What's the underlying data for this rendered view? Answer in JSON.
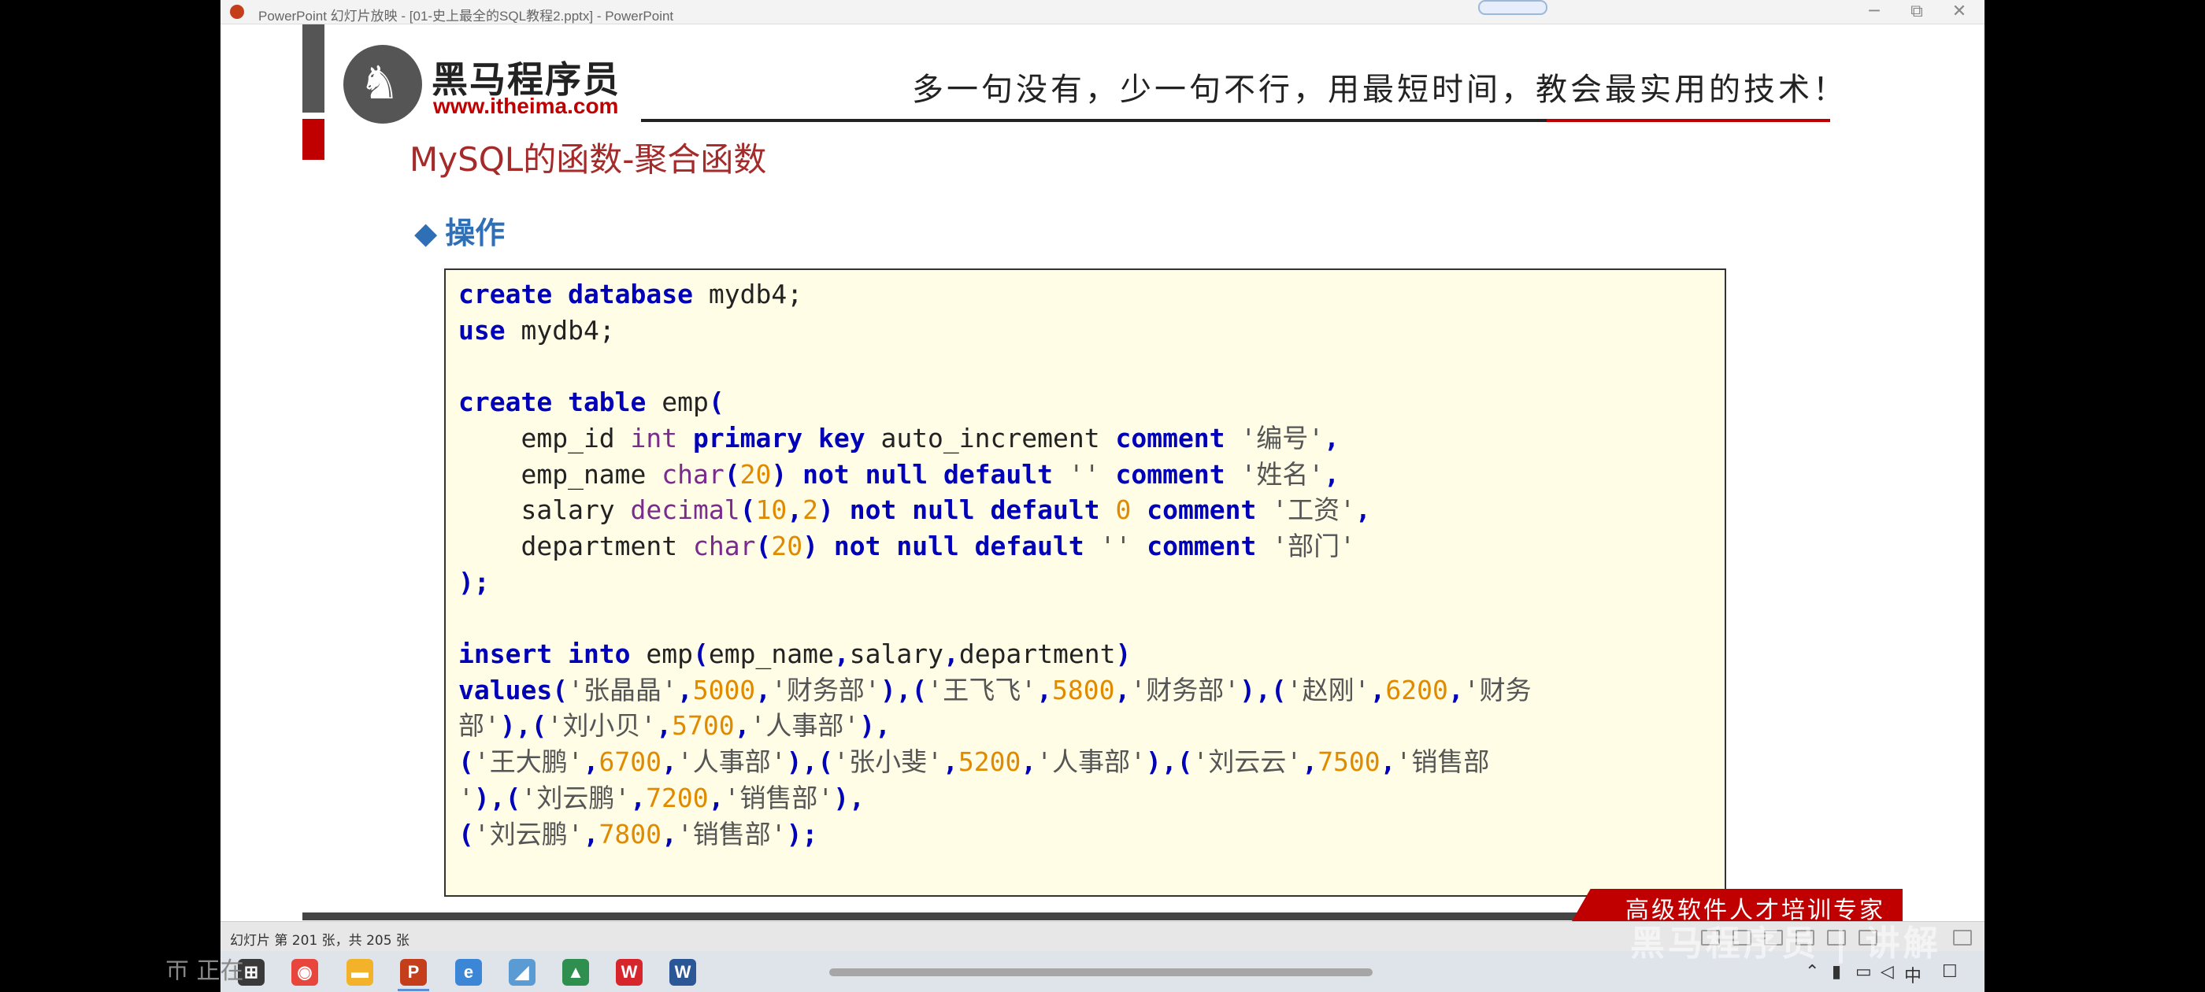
{
  "window": {
    "title": "PowerPoint 幻灯片放映 - [01-史上最全的SQL教程2.pptx] - PowerPoint",
    "controls": {
      "minimize": "─",
      "restore": "⧉",
      "close": "✕"
    }
  },
  "slide": {
    "logo_cn": "黑马程序员",
    "logo_url": "www.itheima.com",
    "slogan": "多一句没有，少一句不行，用最短时间，教会最实用的技术！",
    "title": "MySQL的函数-聚合函数",
    "section_marker": "◆",
    "section": "操作",
    "brand": "高级软件人才培训专家"
  },
  "status": {
    "slide_count": "幻灯片 第 201 张，共 205 张"
  },
  "overlays": {
    "left": "ㄭ 正在",
    "right": "黑马程序员 | 讲解"
  },
  "taskbar": {
    "chinese_mode": "中"
  },
  "colors": {
    "brand_red": "#c00000",
    "title_red": "#a52a2a",
    "section_blue": "#2f6fb6",
    "code_bg": "#fffde6",
    "keyword_blue": "#0000b8",
    "type_purple": "#7a2c8c",
    "number_orange": "#e08a00"
  }
}
